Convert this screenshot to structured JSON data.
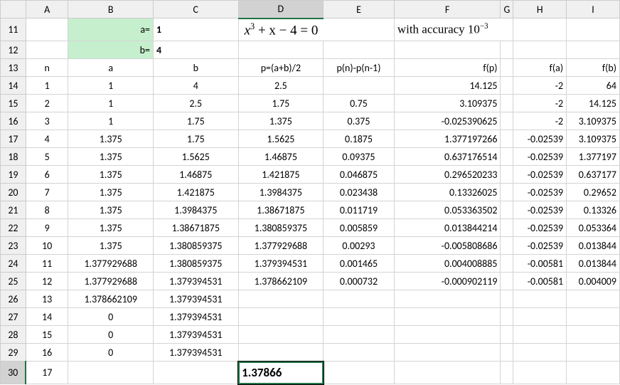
{
  "cols": [
    "A",
    "B",
    "C",
    "D",
    "E",
    "F",
    "G",
    "H",
    "I"
  ],
  "rows": [
    "11",
    "12",
    "13",
    "14",
    "15",
    "16",
    "17",
    "18",
    "19",
    "20",
    "21",
    "22",
    "23",
    "24",
    "25",
    "26",
    "27",
    "28",
    "29",
    "30"
  ],
  "initial": {
    "a_label": "a=",
    "a_val": "1",
    "b_label": "b=",
    "b_val": "4"
  },
  "formula_parts": {
    "x3": "x",
    "exp": "3",
    "plus": " + x − 4 = 0",
    "acc_text": "with accuracy 10",
    "acc_exp": "−3"
  },
  "headers": {
    "n": "n",
    "a": "a",
    "b": "b",
    "p": "p=(a+b)/2",
    "diff": "p(n)-p(n-1)",
    "fp": "f(p)",
    "fa": "f(a)",
    "fb": "f(b)"
  },
  "data_rows": [
    {
      "n": "1",
      "a": "1",
      "b": "4",
      "p": "2.5",
      "diff": "",
      "fp": "14.125",
      "fa": "-2",
      "fb": "64"
    },
    {
      "n": "2",
      "a": "1",
      "b": "2.5",
      "p": "1.75",
      "diff": "0.75",
      "fp": "3.109375",
      "fa": "-2",
      "fb": "14.125"
    },
    {
      "n": "3",
      "a": "1",
      "b": "1.75",
      "p": "1.375",
      "diff": "0.375",
      "fp": "-0.025390625",
      "fa": "-2",
      "fb": "3.109375"
    },
    {
      "n": "4",
      "a": "1.375",
      "b": "1.75",
      "p": "1.5625",
      "diff": "0.1875",
      "fp": "1.377197266",
      "fa": "-0.02539",
      "fb": "3.109375"
    },
    {
      "n": "5",
      "a": "1.375",
      "b": "1.5625",
      "p": "1.46875",
      "diff": "0.09375",
      "fp": "0.637176514",
      "fa": "-0.02539",
      "fb": "1.377197"
    },
    {
      "n": "6",
      "a": "1.375",
      "b": "1.46875",
      "p": "1.421875",
      "diff": "0.046875",
      "fp": "0.296520233",
      "fa": "-0.02539",
      "fb": "0.637177"
    },
    {
      "n": "7",
      "a": "1.375",
      "b": "1.421875",
      "p": "1.3984375",
      "diff": "0.023438",
      "fp": "0.13326025",
      "fa": "-0.02539",
      "fb": "0.29652"
    },
    {
      "n": "8",
      "a": "1.375",
      "b": "1.3984375",
      "p": "1.38671875",
      "diff": "0.011719",
      "fp": "0.053363502",
      "fa": "-0.02539",
      "fb": "0.13326"
    },
    {
      "n": "9",
      "a": "1.375",
      "b": "1.38671875",
      "p": "1.380859375",
      "diff": "0.005859",
      "fp": "0.013844214",
      "fa": "-0.02539",
      "fb": "0.053364"
    },
    {
      "n": "10",
      "a": "1.375",
      "b": "1.380859375",
      "p": "1.377929688",
      "diff": "0.00293",
      "fp": "-0.005808686",
      "fa": "-0.02539",
      "fb": "0.013844"
    },
    {
      "n": "11",
      "a": "1.377929688",
      "b": "1.380859375",
      "p": "1.379394531",
      "diff": "0.001465",
      "fp": "0.004008885",
      "fa": "-0.00581",
      "fb": "0.013844"
    },
    {
      "n": "12",
      "a": "1.377929688",
      "b": "1.379394531",
      "p": "1.378662109",
      "diff": "0.000732",
      "fp": "-0.000902119",
      "fa": "-0.00581",
      "fb": "0.004009"
    },
    {
      "n": "13",
      "a": "1.378662109",
      "b": "1.379394531",
      "p": "",
      "diff": "",
      "fp": "",
      "fa": "",
      "fb": ""
    },
    {
      "n": "14",
      "a": "0",
      "b": "1.379394531",
      "p": "",
      "diff": "",
      "fp": "",
      "fa": "",
      "fb": ""
    },
    {
      "n": "15",
      "a": "0",
      "b": "1.379394531",
      "p": "",
      "diff": "",
      "fp": "",
      "fa": "",
      "fb": ""
    },
    {
      "n": "16",
      "a": "0",
      "b": "1.379394531",
      "p": "",
      "diff": "",
      "fp": "",
      "fa": "",
      "fb": ""
    }
  ],
  "result_row": {
    "n": "17",
    "result": "1.37866"
  },
  "chart_data": {
    "type": "table",
    "title": "Bisection method for x^3 + x - 4 = 0 with accuracy 10^-3",
    "columns": [
      "n",
      "a",
      "b",
      "p=(a+b)/2",
      "p(n)-p(n-1)",
      "f(p)",
      "f(a)",
      "f(b)"
    ],
    "initial_interval": {
      "a": 1,
      "b": 4
    },
    "accuracy": 0.001,
    "root_approx": 1.37866,
    "iterations": [
      {
        "n": 1,
        "a": 1,
        "b": 4,
        "p": 2.5,
        "diff": null,
        "fp": 14.125,
        "fa": -2,
        "fb": 64
      },
      {
        "n": 2,
        "a": 1,
        "b": 2.5,
        "p": 1.75,
        "diff": 0.75,
        "fp": 3.109375,
        "fa": -2,
        "fb": 14.125
      },
      {
        "n": 3,
        "a": 1,
        "b": 1.75,
        "p": 1.375,
        "diff": 0.375,
        "fp": -0.025390625,
        "fa": -2,
        "fb": 3.109375
      },
      {
        "n": 4,
        "a": 1.375,
        "b": 1.75,
        "p": 1.5625,
        "diff": 0.1875,
        "fp": 1.377197266,
        "fa": -0.02539,
        "fb": 3.109375
      },
      {
        "n": 5,
        "a": 1.375,
        "b": 1.5625,
        "p": 1.46875,
        "diff": 0.09375,
        "fp": 0.637176514,
        "fa": -0.02539,
        "fb": 1.377197
      },
      {
        "n": 6,
        "a": 1.375,
        "b": 1.46875,
        "p": 1.421875,
        "diff": 0.046875,
        "fp": 0.296520233,
        "fa": -0.02539,
        "fb": 0.637177
      },
      {
        "n": 7,
        "a": 1.375,
        "b": 1.421875,
        "p": 1.3984375,
        "diff": 0.023438,
        "fp": 0.13326025,
        "fa": -0.02539,
        "fb": 0.29652
      },
      {
        "n": 8,
        "a": 1.375,
        "b": 1.3984375,
        "p": 1.38671875,
        "diff": 0.011719,
        "fp": 0.053363502,
        "fa": -0.02539,
        "fb": 0.13326
      },
      {
        "n": 9,
        "a": 1.375,
        "b": 1.38671875,
        "p": 1.380859375,
        "diff": 0.005859,
        "fp": 0.013844214,
        "fa": -0.02539,
        "fb": 0.053364
      },
      {
        "n": 10,
        "a": 1.375,
        "b": 1.380859375,
        "p": 1.377929688,
        "diff": 0.00293,
        "fp": -0.005808686,
        "fa": -0.02539,
        "fb": 0.013844
      },
      {
        "n": 11,
        "a": 1.377929688,
        "b": 1.380859375,
        "p": 1.379394531,
        "diff": 0.001465,
        "fp": 0.004008885,
        "fa": -0.00581,
        "fb": 0.013844
      },
      {
        "n": 12,
        "a": 1.377929688,
        "b": 1.379394531,
        "p": 1.378662109,
        "diff": 0.000732,
        "fp": -0.000902119,
        "fa": -0.00581,
        "fb": 0.004009
      }
    ]
  }
}
